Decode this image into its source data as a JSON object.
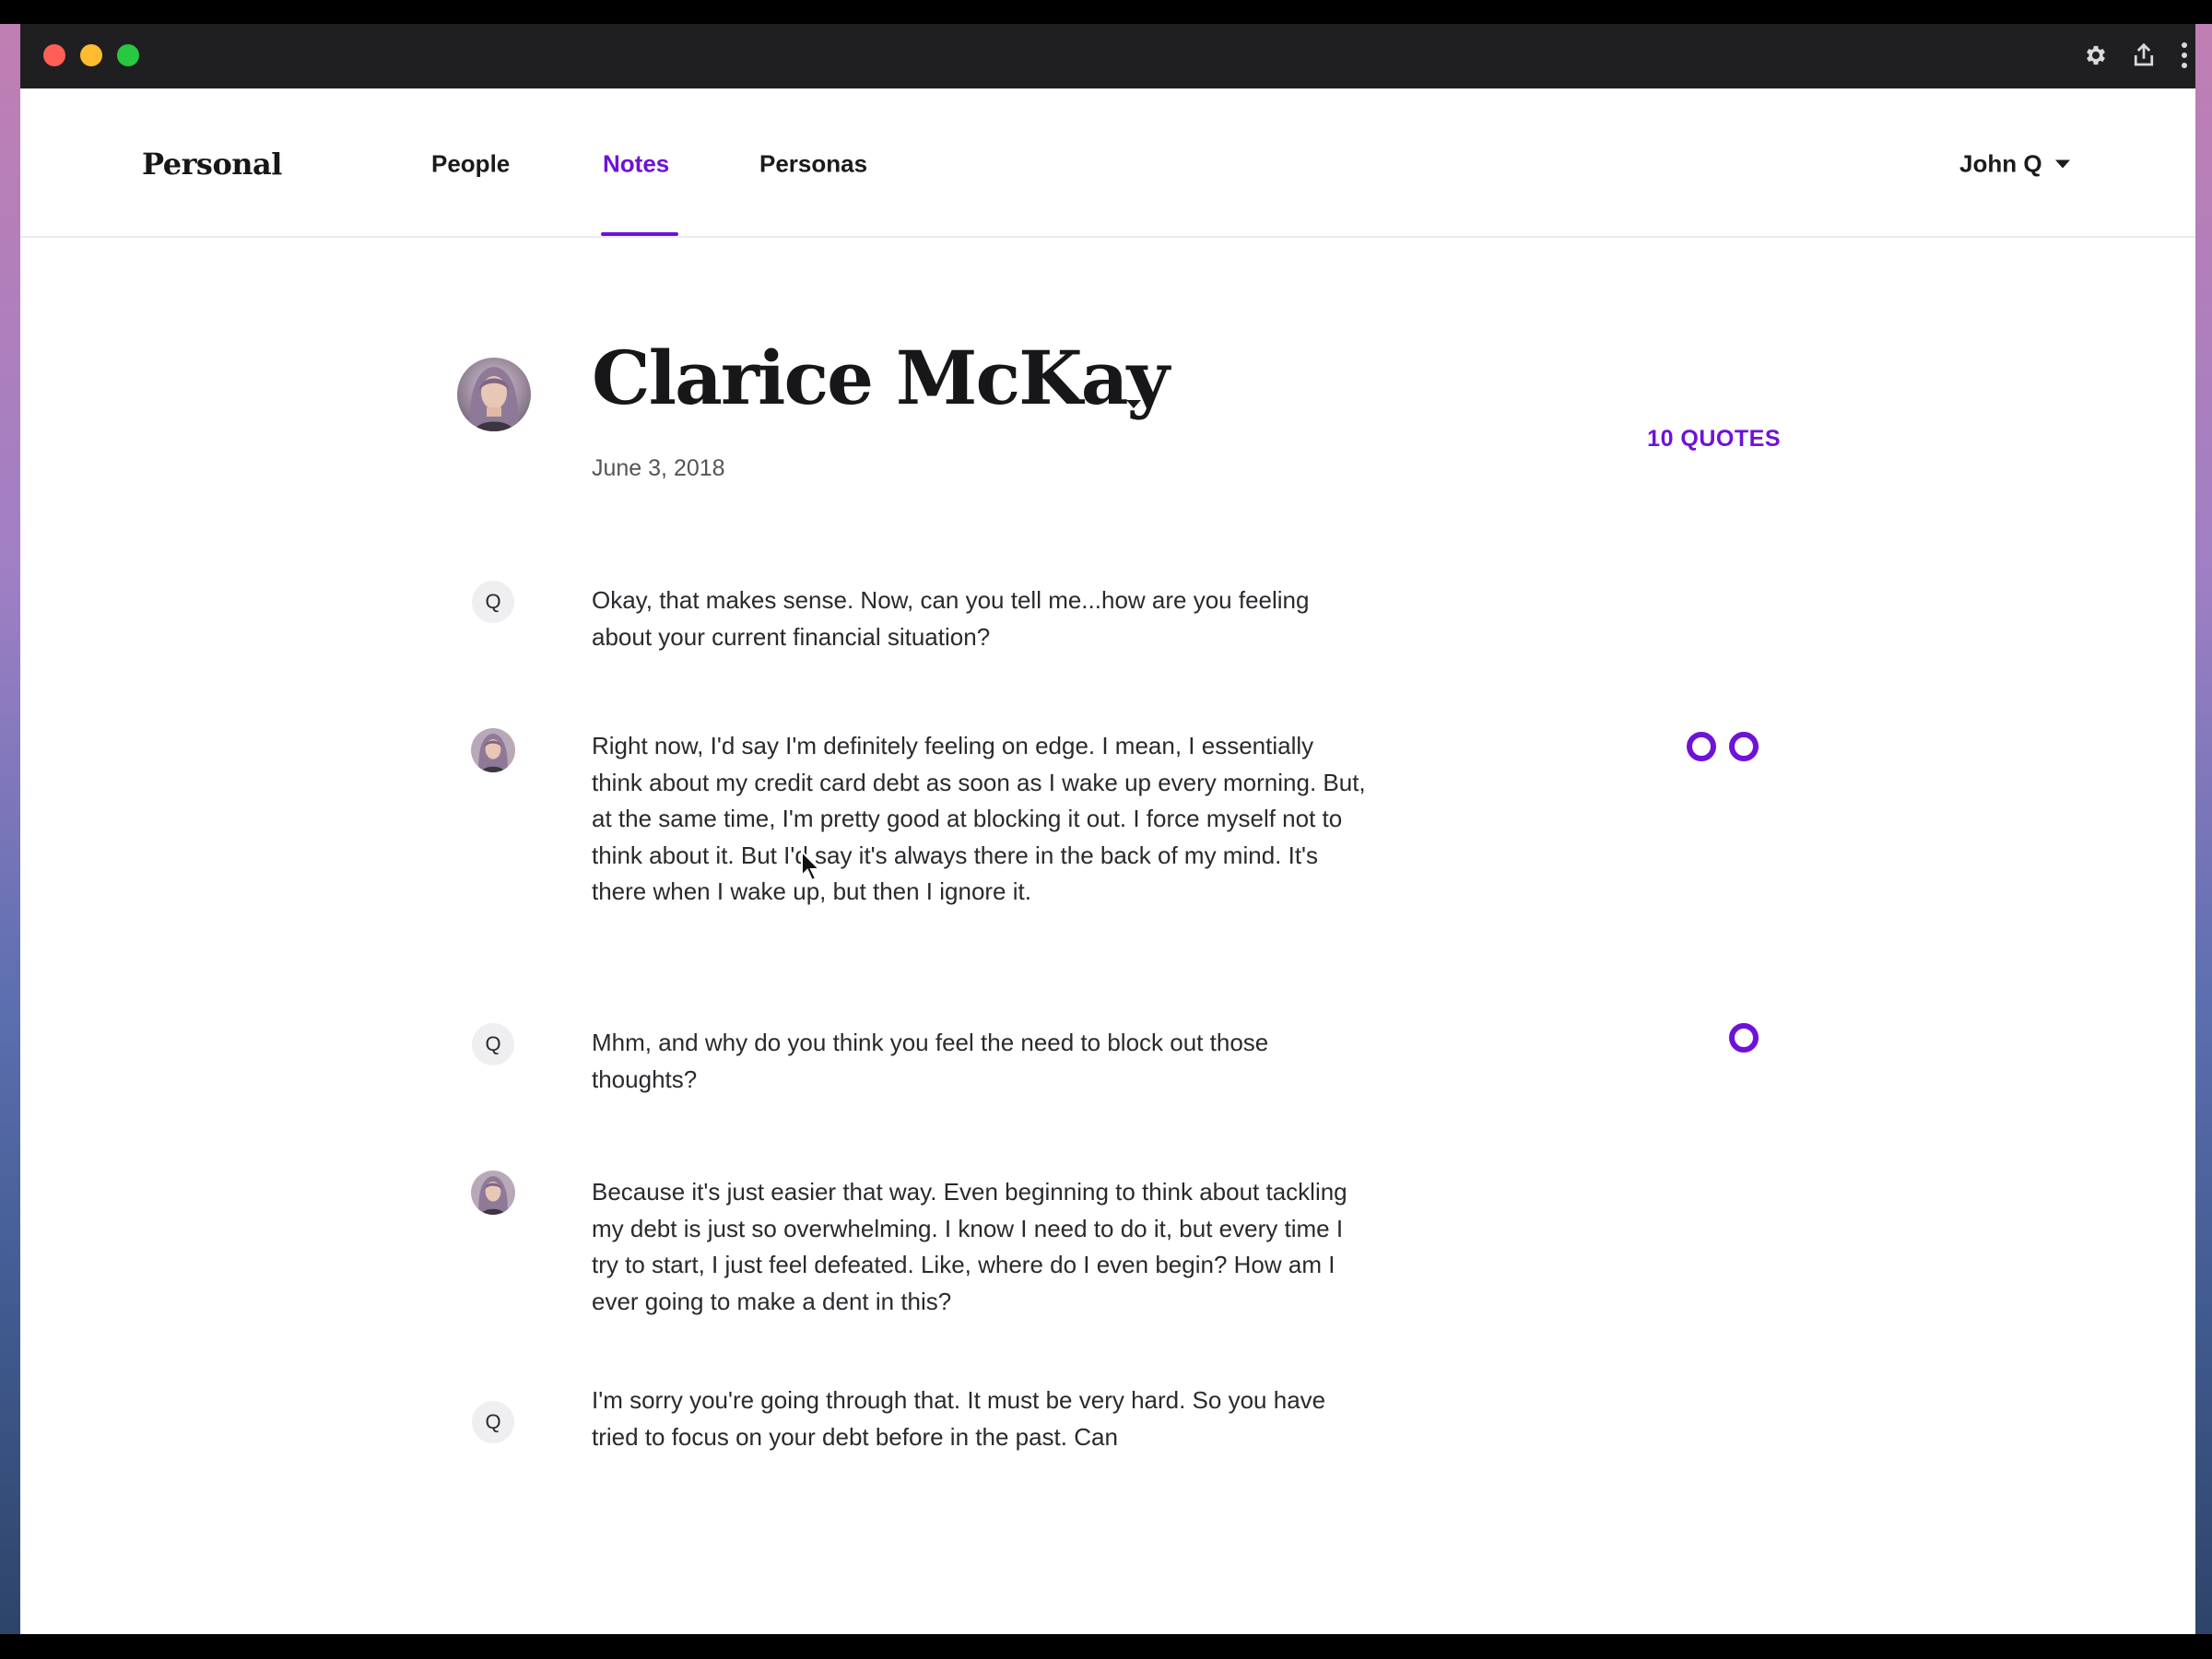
{
  "nav": {
    "brand": "Personal",
    "links": [
      "People",
      "Notes",
      "Personas"
    ],
    "active": "Notes",
    "user": "John Q"
  },
  "header": {
    "name": "Clarice McKay",
    "date": "June 3, 2018",
    "quotes_label": "10 QUOTES"
  },
  "transcript": [
    {
      "speaker": "Q",
      "text": "Okay, that makes sense. Now, can you tell me...how are you feeling about your current financial situation?"
    },
    {
      "speaker": "avatar",
      "text": "Right now, I'd say I'm definitely feeling on edge. I mean, I essentially think about my credit card debt as soon as I wake up every morning. But, at the same time, I'm pretty good at blocking it out. I force myself not to think about it. But I'd say it's always there in the back of my mind. It's there when I wake up, but then I ignore it."
    },
    {
      "speaker": "Q",
      "text": "Mhm, and why do you think you feel the need to block out those thoughts?"
    },
    {
      "speaker": "avatar",
      "text": "Because it's just easier that way. Even beginning to think about tackling my debt is just so overwhelming. I know I need to do it, but every time I try to start, I just feel defeated. Like, where do I even begin? How am I ever going to make a dent in this?"
    },
    {
      "speaker": "Q",
      "text": "I'm sorry you're going through that. It must be very hard. So you have tried to focus on your debt before in the past. Can"
    }
  ],
  "colors": {
    "accent": "#6f12d8",
    "text": "#2a2a2e",
    "titlebar": "#1f1f22"
  },
  "icons": [
    "gear-icon",
    "share-icon",
    "more-vertical-icon",
    "chevron-down-icon",
    "quote-marker-icon"
  ]
}
